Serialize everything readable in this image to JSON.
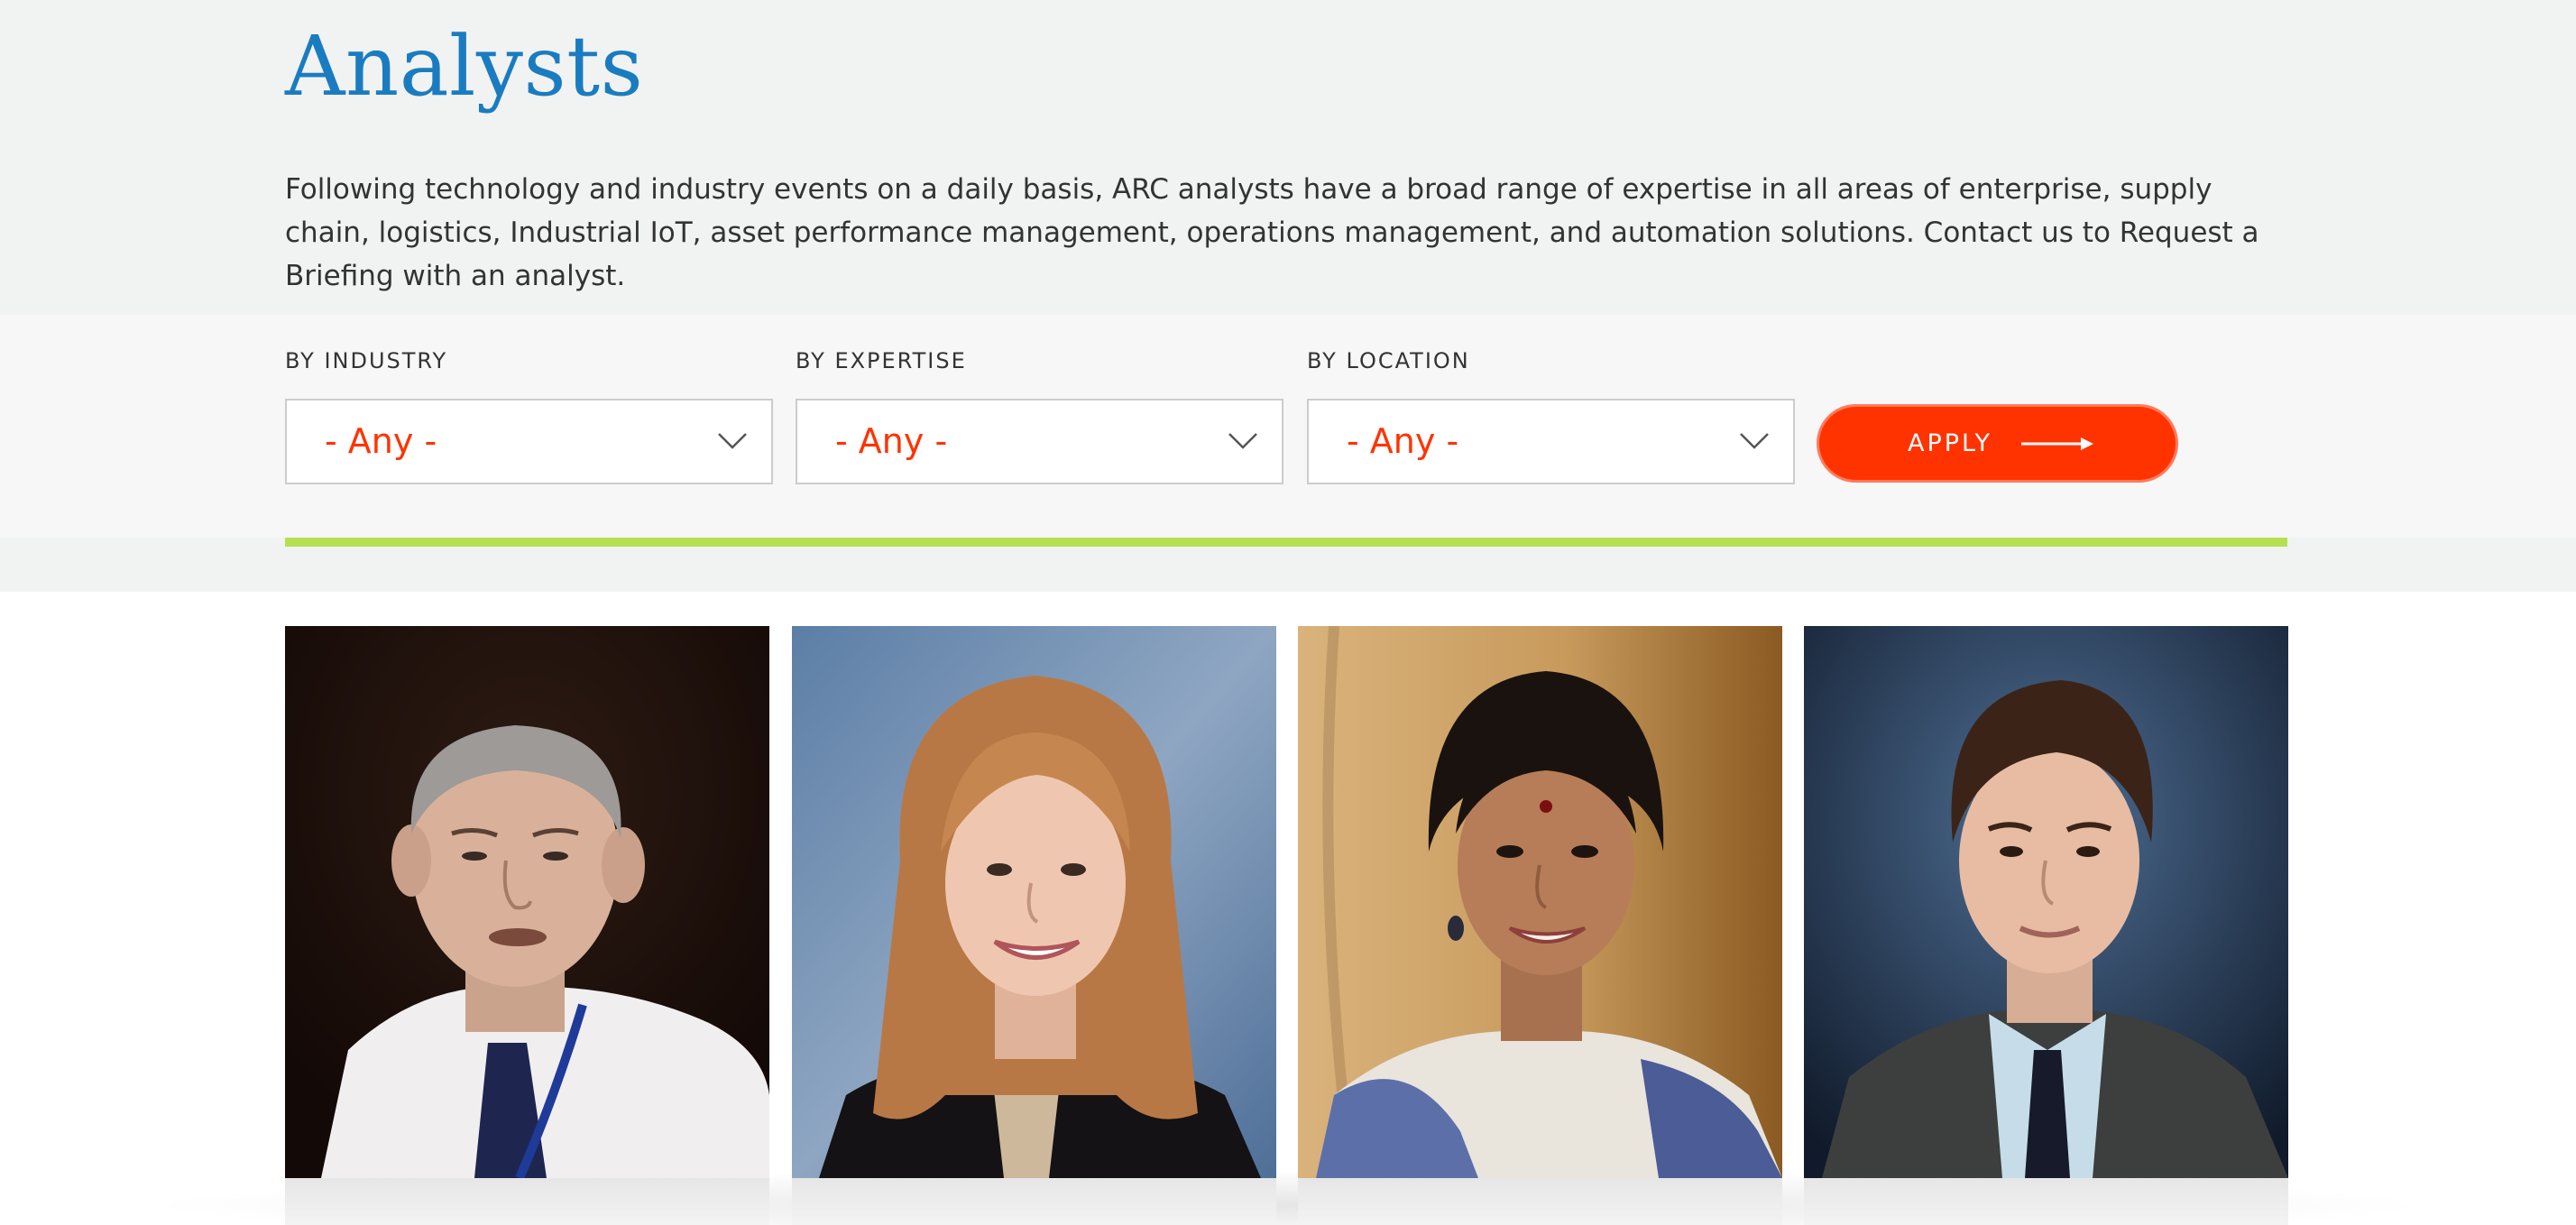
{
  "header": {
    "title": "Analysts",
    "intro": "Following technology and industry events on a daily basis, ARC analysts have a broad range of expertise in all areas of enterprise, supply chain, logistics, Industrial IoT, asset performance management, operations management, and automation solutions. Contact us to Request a Briefing with an analyst."
  },
  "filters": {
    "industry": {
      "label": "BY INDUSTRY",
      "value": "- Any -"
    },
    "expertise": {
      "label": "BY EXPERTISE",
      "value": "- Any -"
    },
    "location": {
      "label": "BY LOCATION",
      "value": "- Any -"
    },
    "apply_label": "APPLY"
  },
  "colors": {
    "title_blue": "#1a7cc0",
    "accent_orange": "#ff3300",
    "rule_green": "#b5e04f",
    "band_gray": "#f1f2f2"
  },
  "icons": [
    "chevron-down-icon",
    "arrow-right-icon"
  ],
  "analysts": [
    {
      "photo": "analyst-photo-1"
    },
    {
      "photo": "analyst-photo-2"
    },
    {
      "photo": "analyst-photo-3"
    },
    {
      "photo": "analyst-photo-4"
    }
  ]
}
